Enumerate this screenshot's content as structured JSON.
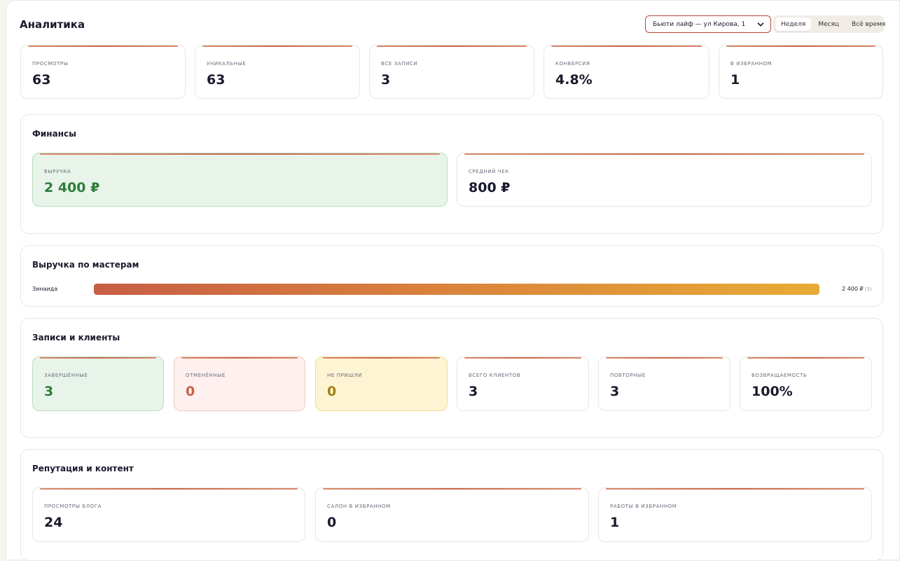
{
  "header": {
    "title": "Аналитика",
    "store_select": {
      "value": "Бьюти лайф — ул Кирова, 1"
    },
    "periods": [
      {
        "label": "Неделя",
        "active": true
      },
      {
        "label": "Месяц",
        "active": false
      },
      {
        "label": "Всё время",
        "active": false
      }
    ]
  },
  "summary": [
    {
      "label": "Просмотры",
      "value": "63"
    },
    {
      "label": "Уникальные",
      "value": "63"
    },
    {
      "label": "Все записи",
      "value": "3"
    },
    {
      "label": "Конверсия",
      "value": "4.8%"
    },
    {
      "label": "В избранном",
      "value": "1"
    }
  ],
  "finance": {
    "title": "Финансы",
    "revenue": {
      "label": "Выручка",
      "value": "2 400 ₽"
    },
    "avg_check": {
      "label": "Средний чек",
      "value": "800 ₽"
    }
  },
  "masters": {
    "title": "Выручка по мастерам",
    "rows": [
      {
        "name": "Зинаида",
        "value": "2 400 ₽",
        "count": "(3)",
        "share": 1.0
      }
    ]
  },
  "bookings": {
    "title": "Записи и клиенты",
    "completed": {
      "label": "Завершённые",
      "value": "3"
    },
    "cancelled": {
      "label": "Отменённые",
      "value": "0"
    },
    "no_show": {
      "label": "Не пришли",
      "value": "0"
    },
    "total_clients": {
      "label": "Всего клиентов",
      "value": "3"
    },
    "repeat": {
      "label": "Повторные",
      "value": "3"
    },
    "retention": {
      "label": "Возвращаемость",
      "value": "100%"
    }
  },
  "reputation": {
    "title": "Репутация и контент",
    "blog_views": {
      "label": "Просмотры блога",
      "value": "24"
    },
    "salon_fav": {
      "label": "Салон в избранном",
      "value": "0"
    },
    "works_fav": {
      "label": "Работы в избранном",
      "value": "1"
    }
  },
  "colors": {
    "accent": "#c9694d",
    "success": "#2e7d3a",
    "danger": "#c9604a",
    "warning": "#a37f12"
  }
}
